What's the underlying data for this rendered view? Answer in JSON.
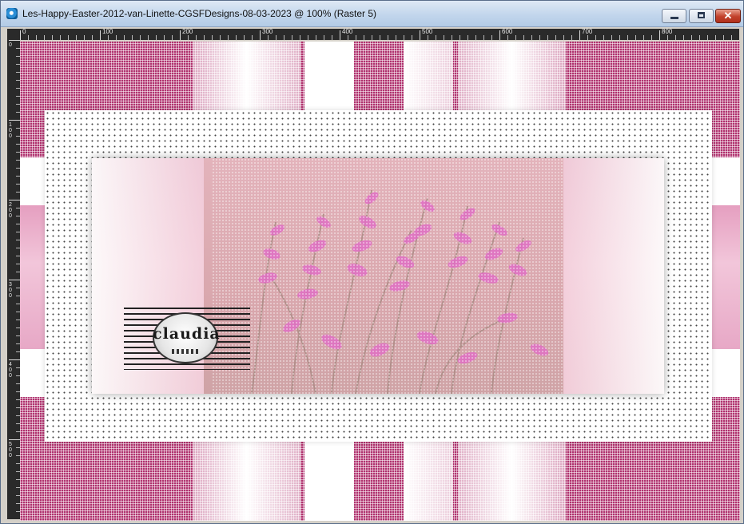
{
  "window": {
    "title": "Les-Happy-Easter-2012-van-Linette-CGSFDesigns-08-03-2023 @ 100% (Raster 5)",
    "controls": {
      "close_symbol": "✕"
    }
  },
  "ruler": {
    "top_labels": [
      "0",
      "100",
      "200",
      "300",
      "400",
      "500",
      "600",
      "700",
      "800"
    ],
    "left_labels": [
      "0",
      "100",
      "200",
      "300",
      "400",
      "500"
    ]
  },
  "canvas": {
    "watermark_text": "claudia"
  },
  "colors": {
    "accent_pink": "#b0326e",
    "light_pink": "#f2c6da",
    "flower_magenta": "#e06fc4"
  }
}
